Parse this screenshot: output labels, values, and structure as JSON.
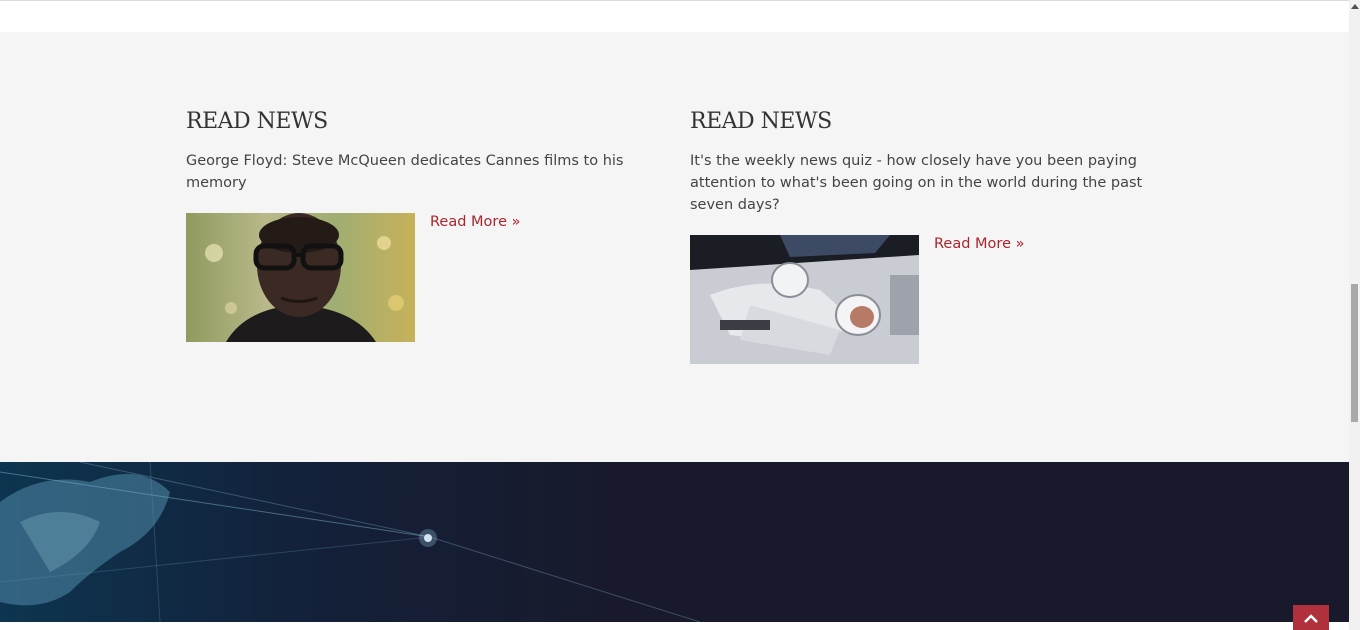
{
  "news": [
    {
      "heading": "READ NEWS",
      "summary": "George Floyd: Steve McQueen dedicates Cannes films to his memory",
      "read_more": "Read More »"
    },
    {
      "heading": "READ NEWS",
      "summary": "It's the weekly news quiz - how closely have you been paying attention to what's been going on in the world during the past seven days?",
      "read_more": "Read More »"
    }
  ],
  "colors": {
    "section_background": "#f5f5f5",
    "link": "#a8262f",
    "back_to_top": "#b0303b",
    "footer": "#181a2b"
  },
  "icons": {
    "back_to_top": "chevron-up-icon"
  }
}
